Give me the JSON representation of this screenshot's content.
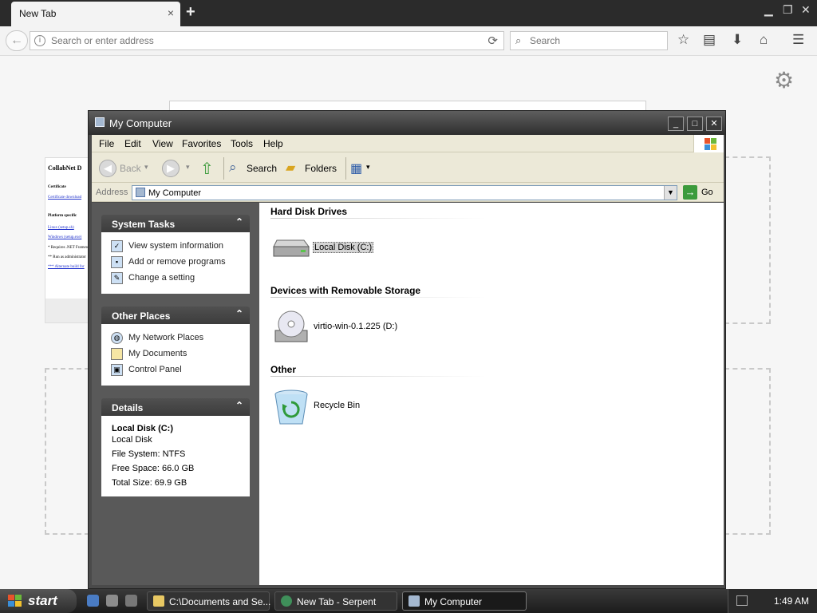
{
  "browser": {
    "tab_title": "New Tab",
    "tab_close": "×",
    "new_tab": "+",
    "url_placeholder": "Search or enter address",
    "search_placeholder": "Search"
  },
  "thumbnail": {
    "title": "CollabNet D",
    "lines": [
      "Certificate",
      "Certificate download",
      "Platform specific",
      "Linux (setup.sh)",
      "Windows (setup.exe)",
      "* Requires .NET Framew",
      "** Run as administrator",
      "*** Alternate build for"
    ]
  },
  "window": {
    "title": "My Computer",
    "menu": [
      "File",
      "Edit",
      "View",
      "Favorites",
      "Tools",
      "Help"
    ],
    "toolbar": {
      "back": "Back",
      "search": "Search",
      "folders": "Folders"
    },
    "address": {
      "label": "Address",
      "value": "My Computer",
      "go": "Go"
    },
    "panels": {
      "system_tasks": {
        "title": "System Tasks",
        "items": [
          "View system information",
          "Add or remove programs",
          "Change a setting"
        ]
      },
      "other_places": {
        "title": "Other Places",
        "items": [
          "My Network Places",
          "My Documents",
          "Control Panel"
        ]
      },
      "details": {
        "title": "Details",
        "name": "Local Disk (C:)",
        "type": "Local Disk",
        "file_system": "File System: NTFS",
        "free_space": "Free Space: 66.0 GB",
        "total_size": "Total Size: 69.9 GB"
      }
    },
    "groups": [
      {
        "heading": "Hard Disk Drives",
        "items": [
          "Local Disk (C:)"
        ]
      },
      {
        "heading": "Devices with Removable Storage",
        "items": [
          "virtio-win-0.1.225 (D:)"
        ]
      },
      {
        "heading": "Other",
        "items": [
          "Recycle Bin"
        ]
      }
    ]
  },
  "taskbar": {
    "start": "start",
    "tasks": [
      "C:\\Documents and Se...",
      "New Tab - Serpent",
      "My Computer"
    ],
    "clock": "1:49 AM"
  }
}
